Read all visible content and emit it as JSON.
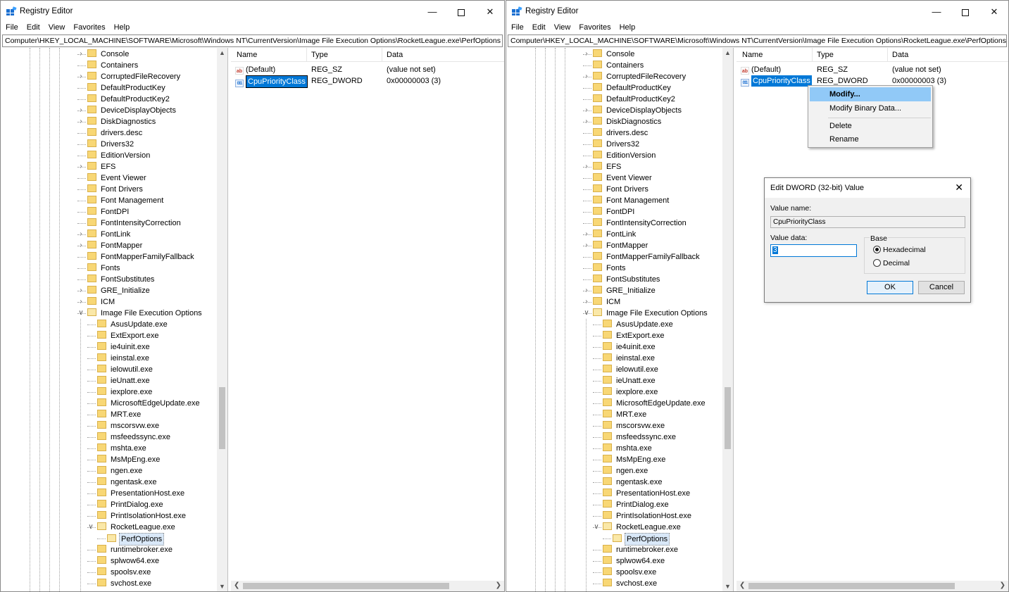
{
  "app_title": "Registry Editor",
  "menu": [
    "File",
    "Edit",
    "View",
    "Favorites",
    "Help"
  ],
  "address": "Computer\\HKEY_LOCAL_MACHINE\\SOFTWARE\\Microsoft\\Windows NT\\CurrentVersion\\Image File Execution Options\\RocketLeague.exe\\PerfOptions",
  "tree_top_items": [
    "Console",
    "Containers",
    "CorruptedFileRecovery",
    "DefaultProductKey",
    "DefaultProductKey2",
    "DeviceDisplayObjects",
    "DiskDiagnostics",
    "drivers.desc",
    "Drivers32",
    "EditionVersion",
    "EFS",
    "Event Viewer",
    "Font Drivers",
    "Font Management",
    "FontDPI",
    "FontIntensityCorrection",
    "FontLink",
    "FontMapper",
    "FontMapperFamilyFallback",
    "Fonts",
    "FontSubstitutes",
    "GRE_Initialize",
    "ICM",
    "Image File Execution Options"
  ],
  "tree_ifeo_children": [
    "AsusUpdate.exe",
    "ExtExport.exe",
    "ie4uinit.exe",
    "ieinstal.exe",
    "ielowutil.exe",
    "ieUnatt.exe",
    "iexplore.exe",
    "MicrosoftEdgeUpdate.exe",
    "MRT.exe",
    "mscorsvw.exe",
    "msfeedssync.exe",
    "mshta.exe",
    "MsMpEng.exe",
    "ngen.exe",
    "ngentask.exe",
    "PresentationHost.exe",
    "PrintDialog.exe",
    "PrintIsolationHost.exe",
    "RocketLeague.exe"
  ],
  "tree_selected": "PerfOptions",
  "tree_after": [
    "runtimebroker.exe",
    "splwow64.exe",
    "spoolsv.exe",
    "svchost.exe"
  ],
  "columns": {
    "name": "Name",
    "type": "Type",
    "data": "Data"
  },
  "values": [
    {
      "name": "(Default)",
      "type": "REG_SZ",
      "data": "(value not set)",
      "icon": "string-value-icon"
    },
    {
      "name": "CpuPriorityClass",
      "type": "REG_DWORD",
      "data": "0x00000003 (3)",
      "icon": "binary-value-icon"
    }
  ],
  "context_menu": [
    "Modify...",
    "Modify Binary Data...",
    "Delete",
    "Rename"
  ],
  "dialog": {
    "title": "Edit DWORD (32-bit) Value",
    "value_name_label": "Value name:",
    "value_name": "CpuPriorityClass",
    "value_data_label": "Value data:",
    "value_data": "3",
    "base_label": "Base",
    "base_options": [
      "Hexadecimal",
      "Decimal"
    ],
    "base_selected": "Hexadecimal",
    "ok_label": "OK",
    "cancel_label": "Cancel"
  },
  "colors": {
    "selection": "#0078d7",
    "menu_highlight": "#91c9f7",
    "folder": "#f8d775"
  }
}
